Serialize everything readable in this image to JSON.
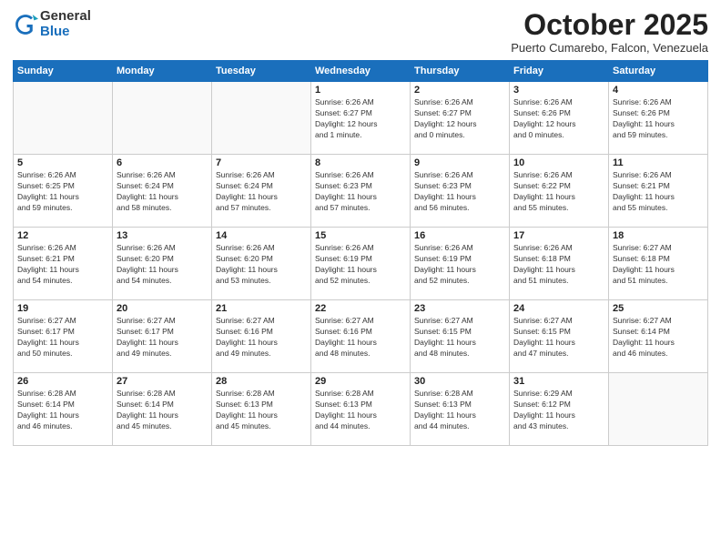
{
  "logo": {
    "general": "General",
    "blue": "Blue"
  },
  "title": "October 2025",
  "subtitle": "Puerto Cumarebo, Falcon, Venezuela",
  "days_of_week": [
    "Sunday",
    "Monday",
    "Tuesday",
    "Wednesday",
    "Thursday",
    "Friday",
    "Saturday"
  ],
  "weeks": [
    [
      {
        "day": "",
        "info": ""
      },
      {
        "day": "",
        "info": ""
      },
      {
        "day": "",
        "info": ""
      },
      {
        "day": "1",
        "info": "Sunrise: 6:26 AM\nSunset: 6:27 PM\nDaylight: 12 hours\nand 1 minute."
      },
      {
        "day": "2",
        "info": "Sunrise: 6:26 AM\nSunset: 6:27 PM\nDaylight: 12 hours\nand 0 minutes."
      },
      {
        "day": "3",
        "info": "Sunrise: 6:26 AM\nSunset: 6:26 PM\nDaylight: 12 hours\nand 0 minutes."
      },
      {
        "day": "4",
        "info": "Sunrise: 6:26 AM\nSunset: 6:26 PM\nDaylight: 11 hours\nand 59 minutes."
      }
    ],
    [
      {
        "day": "5",
        "info": "Sunrise: 6:26 AM\nSunset: 6:25 PM\nDaylight: 11 hours\nand 59 minutes."
      },
      {
        "day": "6",
        "info": "Sunrise: 6:26 AM\nSunset: 6:24 PM\nDaylight: 11 hours\nand 58 minutes."
      },
      {
        "day": "7",
        "info": "Sunrise: 6:26 AM\nSunset: 6:24 PM\nDaylight: 11 hours\nand 57 minutes."
      },
      {
        "day": "8",
        "info": "Sunrise: 6:26 AM\nSunset: 6:23 PM\nDaylight: 11 hours\nand 57 minutes."
      },
      {
        "day": "9",
        "info": "Sunrise: 6:26 AM\nSunset: 6:23 PM\nDaylight: 11 hours\nand 56 minutes."
      },
      {
        "day": "10",
        "info": "Sunrise: 6:26 AM\nSunset: 6:22 PM\nDaylight: 11 hours\nand 55 minutes."
      },
      {
        "day": "11",
        "info": "Sunrise: 6:26 AM\nSunset: 6:21 PM\nDaylight: 11 hours\nand 55 minutes."
      }
    ],
    [
      {
        "day": "12",
        "info": "Sunrise: 6:26 AM\nSunset: 6:21 PM\nDaylight: 11 hours\nand 54 minutes."
      },
      {
        "day": "13",
        "info": "Sunrise: 6:26 AM\nSunset: 6:20 PM\nDaylight: 11 hours\nand 54 minutes."
      },
      {
        "day": "14",
        "info": "Sunrise: 6:26 AM\nSunset: 6:20 PM\nDaylight: 11 hours\nand 53 minutes."
      },
      {
        "day": "15",
        "info": "Sunrise: 6:26 AM\nSunset: 6:19 PM\nDaylight: 11 hours\nand 52 minutes."
      },
      {
        "day": "16",
        "info": "Sunrise: 6:26 AM\nSunset: 6:19 PM\nDaylight: 11 hours\nand 52 minutes."
      },
      {
        "day": "17",
        "info": "Sunrise: 6:26 AM\nSunset: 6:18 PM\nDaylight: 11 hours\nand 51 minutes."
      },
      {
        "day": "18",
        "info": "Sunrise: 6:27 AM\nSunset: 6:18 PM\nDaylight: 11 hours\nand 51 minutes."
      }
    ],
    [
      {
        "day": "19",
        "info": "Sunrise: 6:27 AM\nSunset: 6:17 PM\nDaylight: 11 hours\nand 50 minutes."
      },
      {
        "day": "20",
        "info": "Sunrise: 6:27 AM\nSunset: 6:17 PM\nDaylight: 11 hours\nand 49 minutes."
      },
      {
        "day": "21",
        "info": "Sunrise: 6:27 AM\nSunset: 6:16 PM\nDaylight: 11 hours\nand 49 minutes."
      },
      {
        "day": "22",
        "info": "Sunrise: 6:27 AM\nSunset: 6:16 PM\nDaylight: 11 hours\nand 48 minutes."
      },
      {
        "day": "23",
        "info": "Sunrise: 6:27 AM\nSunset: 6:15 PM\nDaylight: 11 hours\nand 48 minutes."
      },
      {
        "day": "24",
        "info": "Sunrise: 6:27 AM\nSunset: 6:15 PM\nDaylight: 11 hours\nand 47 minutes."
      },
      {
        "day": "25",
        "info": "Sunrise: 6:27 AM\nSunset: 6:14 PM\nDaylight: 11 hours\nand 46 minutes."
      }
    ],
    [
      {
        "day": "26",
        "info": "Sunrise: 6:28 AM\nSunset: 6:14 PM\nDaylight: 11 hours\nand 46 minutes."
      },
      {
        "day": "27",
        "info": "Sunrise: 6:28 AM\nSunset: 6:14 PM\nDaylight: 11 hours\nand 45 minutes."
      },
      {
        "day": "28",
        "info": "Sunrise: 6:28 AM\nSunset: 6:13 PM\nDaylight: 11 hours\nand 45 minutes."
      },
      {
        "day": "29",
        "info": "Sunrise: 6:28 AM\nSunset: 6:13 PM\nDaylight: 11 hours\nand 44 minutes."
      },
      {
        "day": "30",
        "info": "Sunrise: 6:28 AM\nSunset: 6:13 PM\nDaylight: 11 hours\nand 44 minutes."
      },
      {
        "day": "31",
        "info": "Sunrise: 6:29 AM\nSunset: 6:12 PM\nDaylight: 11 hours\nand 43 minutes."
      },
      {
        "day": "",
        "info": ""
      }
    ]
  ]
}
